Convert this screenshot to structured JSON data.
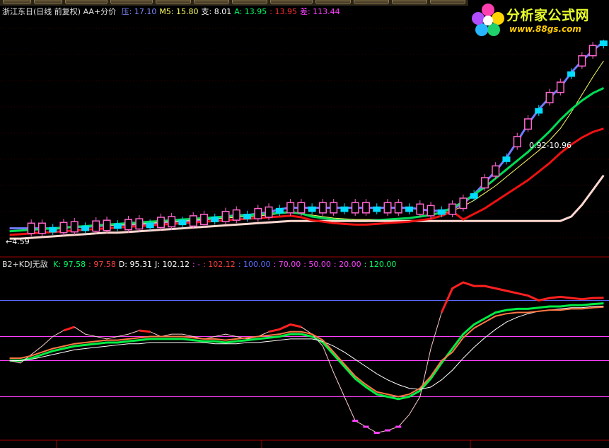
{
  "main_panel": {
    "title": "浙江东日(日线 前复权) AA+分价",
    "indicators": [
      {
        "label": "压: 17.10",
        "color": "#7f8cff"
      },
      {
        "label": "M5: 15.80",
        "color": "#ffff66"
      },
      {
        "label": "支: 8.01",
        "color": "#ffffff"
      },
      {
        "label": "A: 13.95",
        "color": "#00ff66"
      },
      {
        "label": ": 13.95",
        "color": "#ff3030"
      },
      {
        "label": "差: 113.44",
        "color": "#ff40ff"
      }
    ],
    "price_annotation_low": "←4.59",
    "price_annotation_range": "0.92-10.96"
  },
  "kdj_panel": {
    "title": "B2+KDJ无敌",
    "indicators": [
      {
        "label": "K: 97.58",
        "color": "#00ff66"
      },
      {
        "label": ": 97.58",
        "color": "#ff4040"
      },
      {
        "label": "D: 95.31",
        "color": "#ffffff"
      },
      {
        "label": "J: 102.12",
        "color": "#ffffff"
      },
      {
        "label": ": -",
        "color": "#ff40ff"
      },
      {
        "label": ": 102.12",
        "color": "#ff4040"
      },
      {
        "label": ": 100.00",
        "color": "#5a6cff"
      },
      {
        "label": ": 70.00",
        "color": "#ff40ff"
      },
      {
        "label": ": 50.00",
        "color": "#ff40ff"
      },
      {
        "label": ": 20.00",
        "color": "#ff40ff"
      },
      {
        "label": ": 120.00",
        "color": "#00ff66"
      }
    ]
  },
  "logo": {
    "text": "分析家公式网",
    "url": "www.88gs.com"
  },
  "chart_data": [
    {
      "type": "candlestick",
      "title": "浙江东日(日线 前复权) AA+分价",
      "series": [
        {
          "name": "压",
          "color": "#7f8cff",
          "values": [
            4.4,
            4.4,
            4.4,
            4.4,
            4.4,
            4.45,
            4.5,
            4.5,
            4.55,
            4.6,
            4.65,
            4.65,
            4.7,
            4.7,
            4.8,
            4.85,
            4.9,
            4.9,
            5.0,
            5.1,
            5.2,
            5.3,
            5.3,
            5.4,
            5.5,
            5.7,
            5.8,
            5.8,
            5.8,
            5.8,
            5.8,
            5.8,
            5.8,
            5.8,
            5.8,
            5.8,
            5.8,
            5.8,
            5.7,
            5.6,
            5.6,
            5.7,
            6.1,
            6.7,
            7.5,
            8.3,
            9.2,
            10.3,
            11.5,
            12.5,
            13.3,
            14.0,
            15.0,
            15.8,
            16.5,
            17.1
          ]
        },
        {
          "name": "M5",
          "color": "#ffff66",
          "values": [
            null,
            null,
            null,
            null,
            4.3,
            4.4,
            4.45,
            4.5,
            4.55,
            4.58,
            4.62,
            4.65,
            4.7,
            4.75,
            4.8,
            4.85,
            4.9,
            4.95,
            5.0,
            5.05,
            5.1,
            5.15,
            5.2,
            5.25,
            5.3,
            5.4,
            5.45,
            5.4,
            5.3,
            5.2,
            5.1,
            5.05,
            5.0,
            5.0,
            5.0,
            5.0,
            5.05,
            5.1,
            5.2,
            5.3,
            5.4,
            5.6,
            5.9,
            6.3,
            6.8,
            7.3,
            7.9,
            8.5,
            9.1,
            9.7,
            10.4,
            11.2,
            12.3,
            13.5,
            14.7,
            15.8
          ]
        },
        {
          "name": "A",
          "color": "#00ff66",
          "values": [
            4.2,
            4.25,
            4.3,
            4.35,
            4.4,
            4.45,
            4.5,
            4.55,
            4.6,
            4.65,
            4.7,
            4.75,
            4.8,
            4.85,
            4.9,
            4.95,
            5.0,
            5.05,
            5.1,
            5.15,
            5.2,
            5.25,
            5.3,
            5.35,
            5.4,
            5.45,
            5.5,
            5.4,
            5.2,
            5.1,
            5.0,
            4.95,
            4.9,
            4.9,
            4.95,
            5.0,
            5.05,
            5.1,
            5.2,
            5.3,
            5.5,
            5.8,
            6.2,
            6.7,
            7.2,
            7.8,
            8.4,
            9.0,
            9.6,
            10.3,
            11.0,
            11.8,
            12.5,
            13.1,
            13.6,
            13.95
          ]
        },
        {
          "name": "支",
          "color": "#ffffff",
          "values": [
            3.7,
            3.7,
            3.75,
            3.8,
            3.85,
            3.9,
            3.95,
            4.0,
            4.05,
            4.1,
            4.1,
            4.15,
            4.2,
            4.25,
            4.3,
            4.35,
            4.4,
            4.45,
            4.5,
            4.55,
            4.6,
            4.65,
            4.7,
            4.75,
            4.8,
            4.85,
            4.9,
            4.9,
            4.9,
            4.9,
            4.9,
            4.9,
            4.9,
            4.9,
            4.9,
            4.9,
            4.9,
            4.9,
            4.9,
            4.9,
            4.9,
            4.9,
            4.9,
            4.9,
            4.9,
            4.9,
            4.9,
            4.9,
            4.9,
            4.9,
            4.9,
            4.9,
            5.2,
            6.0,
            7.0,
            8.01
          ]
        }
      ]
    },
    {
      "type": "line",
      "title": "B2+KDJ无敌",
      "reference_lines": [
        100,
        70,
        50,
        20,
        120
      ],
      "series": [
        {
          "name": "K",
          "color": "#00ff66",
          "values": [
            50,
            50,
            52,
            55,
            58,
            60,
            62,
            63,
            64,
            65,
            65,
            66,
            67,
            68,
            68,
            68,
            68,
            67,
            66,
            66,
            65,
            66,
            67,
            68,
            69,
            70,
            72,
            72,
            70,
            65,
            55,
            45,
            35,
            28,
            22,
            20,
            18,
            20,
            25,
            35,
            48,
            60,
            72,
            80,
            85,
            90,
            92,
            93,
            93,
            94,
            95,
            95,
            96,
            96,
            97,
            97.58
          ]
        },
        {
          "name": "D",
          "color": "#ffffff",
          "values": [
            50,
            50,
            51,
            53,
            55,
            57,
            59,
            60,
            61,
            62,
            63,
            64,
            64,
            65,
            65,
            65,
            65,
            65,
            65,
            64,
            64,
            64,
            65,
            65,
            66,
            67,
            68,
            68,
            68,
            66,
            62,
            57,
            51,
            45,
            39,
            34,
            30,
            27,
            26,
            28,
            34,
            42,
            52,
            61,
            69,
            76,
            82,
            86,
            89,
            91,
            92,
            93,
            94,
            94,
            95,
            95.31
          ]
        },
        {
          "name": "J",
          "color": "#ffffff",
          "values": [
            50,
            48,
            55,
            62,
            70,
            75,
            78,
            72,
            70,
            68,
            70,
            72,
            75,
            74,
            70,
            72,
            72,
            70,
            68,
            70,
            72,
            70,
            68,
            70,
            74,
            76,
            80,
            78,
            72,
            62,
            40,
            20,
            0,
            -5,
            -10,
            -8,
            -5,
            5,
            20,
            60,
            90,
            110,
            115,
            112,
            112,
            110,
            108,
            106,
            104,
            100,
            102,
            103,
            102,
            101,
            102,
            102.12
          ]
        }
      ]
    }
  ]
}
